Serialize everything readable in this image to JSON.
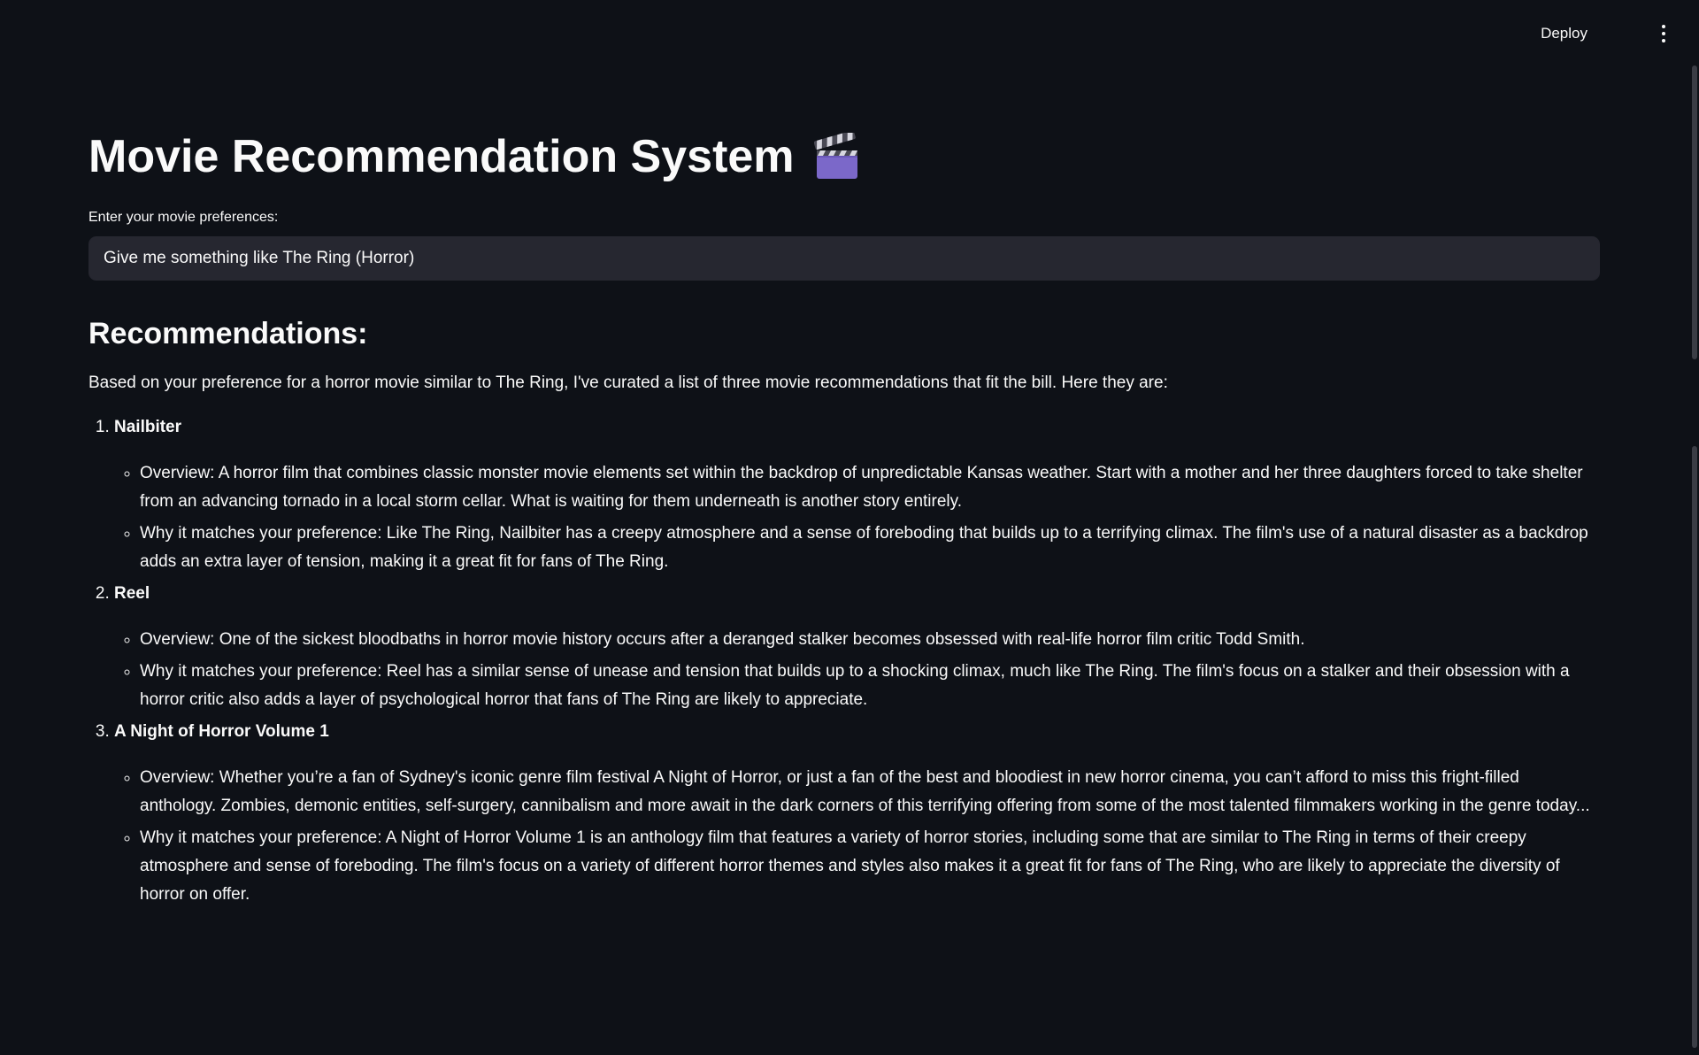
{
  "header": {
    "deploy_label": "Deploy",
    "menu_icon": "vertical-ellipsis-icon"
  },
  "page": {
    "title": "Movie Recommendation System",
    "title_icon": "clapper-board-icon"
  },
  "input": {
    "label": "Enter your movie preferences:",
    "value": "Give me something like The Ring (Horror)"
  },
  "results": {
    "heading": "Recommendations:",
    "intro": "Based on your preference for a horror movie similar to The Ring, I've curated a list of three movie recommendations that fit the bill. Here they are:",
    "items": [
      {
        "title": "Nailbiter",
        "overview": "Overview: A horror film that combines classic monster movie elements set within the backdrop of unpredictable Kansas weather. Start with a mother and her three daughters forced to take shelter from an advancing tornado in a local storm cellar. What is waiting for them underneath is another story entirely.",
        "why": "Why it matches your preference: Like The Ring, Nailbiter has a creepy atmosphere and a sense of foreboding that builds up to a terrifying climax. The film's use of a natural disaster as a backdrop adds an extra layer of tension, making it a great fit for fans of The Ring."
      },
      {
        "title": "Reel",
        "overview": "Overview: One of the sickest bloodbaths in horror movie history occurs after a deranged stalker becomes obsessed with real-life horror film critic Todd Smith.",
        "why": "Why it matches your preference: Reel has a similar sense of unease and tension that builds up to a shocking climax, much like The Ring. The film's focus on a stalker and their obsession with a horror critic also adds a layer of psychological horror that fans of The Ring are likely to appreciate."
      },
      {
        "title": "A Night of Horror Volume 1",
        "overview": "Overview: Whether you’re a fan of Sydney's iconic genre film festival A Night of Horror, or just a fan of the best and bloodiest in new horror cinema, you can’t afford to miss this fright-filled anthology. Zombies, demonic entities, self-surgery, cannibalism and more await in the dark corners of this terrifying offering from some of the most talented filmmakers working in the genre today...",
        "why": "Why it matches your preference: A Night of Horror Volume 1 is an anthology film that features a variety of horror stories, including some that are similar to The Ring in terms of their creepy atmosphere and sense of foreboding. The film's focus on a variety of different horror themes and styles also makes it a great fit for fans of The Ring, who are likely to appreciate the diversity of horror on offer."
      }
    ]
  },
  "colors": {
    "background": "#0e1117",
    "input_background": "#262730",
    "text": "#fafafa"
  }
}
